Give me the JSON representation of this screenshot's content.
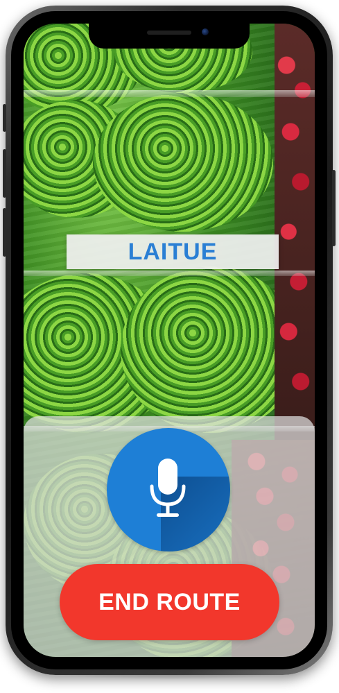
{
  "scan": {
    "product_name": "LAITUE"
  },
  "controls": {
    "end_route_label": "END ROUTE",
    "mic_icon": "microphone-icon"
  },
  "colors": {
    "accent_blue": "#1e7fd6",
    "label_text_blue": "#2a7fd4",
    "end_red": "#f2372c"
  }
}
